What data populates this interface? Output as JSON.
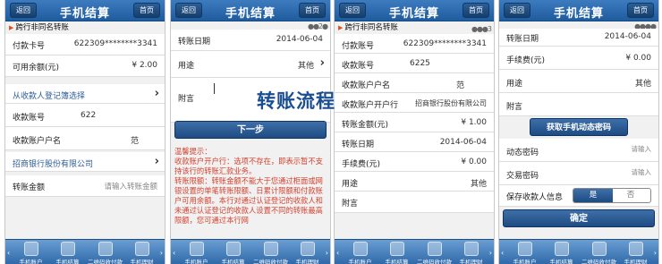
{
  "overlay_title": "转账流程",
  "common": {
    "back": "返回",
    "home": "首页",
    "title": "手机结算",
    "tabs": [
      "手机账户",
      "手机结算",
      "二维码收付款",
      "手机理财"
    ],
    "tab_edge_left": "‹",
    "tab_edge_right": "›"
  },
  "screen1": {
    "section": "跨行非同名转账",
    "rows": [
      {
        "label": "付款卡号",
        "value": "622309********3341"
      },
      {
        "label": "可用余额(元)",
        "value": "¥ 2.00"
      }
    ],
    "select_payee": "从收款人登记簿选择",
    "payee_account_label": "收款账号",
    "payee_account_value": "622",
    "payee_name_label": "收款账户户名",
    "payee_name_value": "范",
    "bank": "招商银行股份有限公司",
    "amount_label": "转账金额",
    "amount_placeholder": "请输入转账金额"
  },
  "screen2": {
    "steps": "●●2●",
    "rows": [
      {
        "label": "转账日期",
        "value": "2014-06-04"
      },
      {
        "label": "用途",
        "value": "其他"
      }
    ],
    "note_label": "附言",
    "next_button": "下一步",
    "tip": "温馨提示：\n收款账户开户行：选项不存在，即表示暂不支持该行的转账汇款业务。\n转账限额：转账金额不能大于您通过柜面或网银设置的单笔转账限额、日累计限额和付款账户可用余额。本行对通过认证登记的收款人和未通过认证登记的收款人设置不同的转账最高限额，您可通过本行网"
  },
  "screen3": {
    "section": "跨行非同名转账",
    "steps": "●●●3",
    "rows": [
      {
        "label": "付款账号",
        "value": "622309********3341"
      },
      {
        "label": "收款账号",
        "value": "6225"
      },
      {
        "label": "收款账户户名",
        "value": "范"
      },
      {
        "label": "收款账户开户行",
        "value": "招商银行股份有限公司"
      },
      {
        "label": "转账金额(元)",
        "value": "¥ 1.00"
      },
      {
        "label": "转账日期",
        "value": "2014-06-04"
      },
      {
        "label": "手续费(元)",
        "value": "¥ 0.00"
      },
      {
        "label": "用途",
        "value": "其他"
      },
      {
        "label": "附言",
        "value": ""
      }
    ]
  },
  "screen4": {
    "steps": "●●●●",
    "rows": [
      {
        "label": "转账日期",
        "value": "2014-06-04"
      },
      {
        "label": "手续费(元)",
        "value": "¥ 0.00"
      },
      {
        "label": "用途",
        "value": "其他"
      },
      {
        "label": "附言",
        "value": ""
      }
    ],
    "sms_button": "获取手机动态密码",
    "dyn_label": "动态密码",
    "dyn_placeholder": "请输入",
    "trade_label": "交易密码",
    "trade_placeholder": "请输入",
    "save_label": "保存收款人信息",
    "save_yes": "是",
    "save_no": "否",
    "confirm": "确定"
  }
}
